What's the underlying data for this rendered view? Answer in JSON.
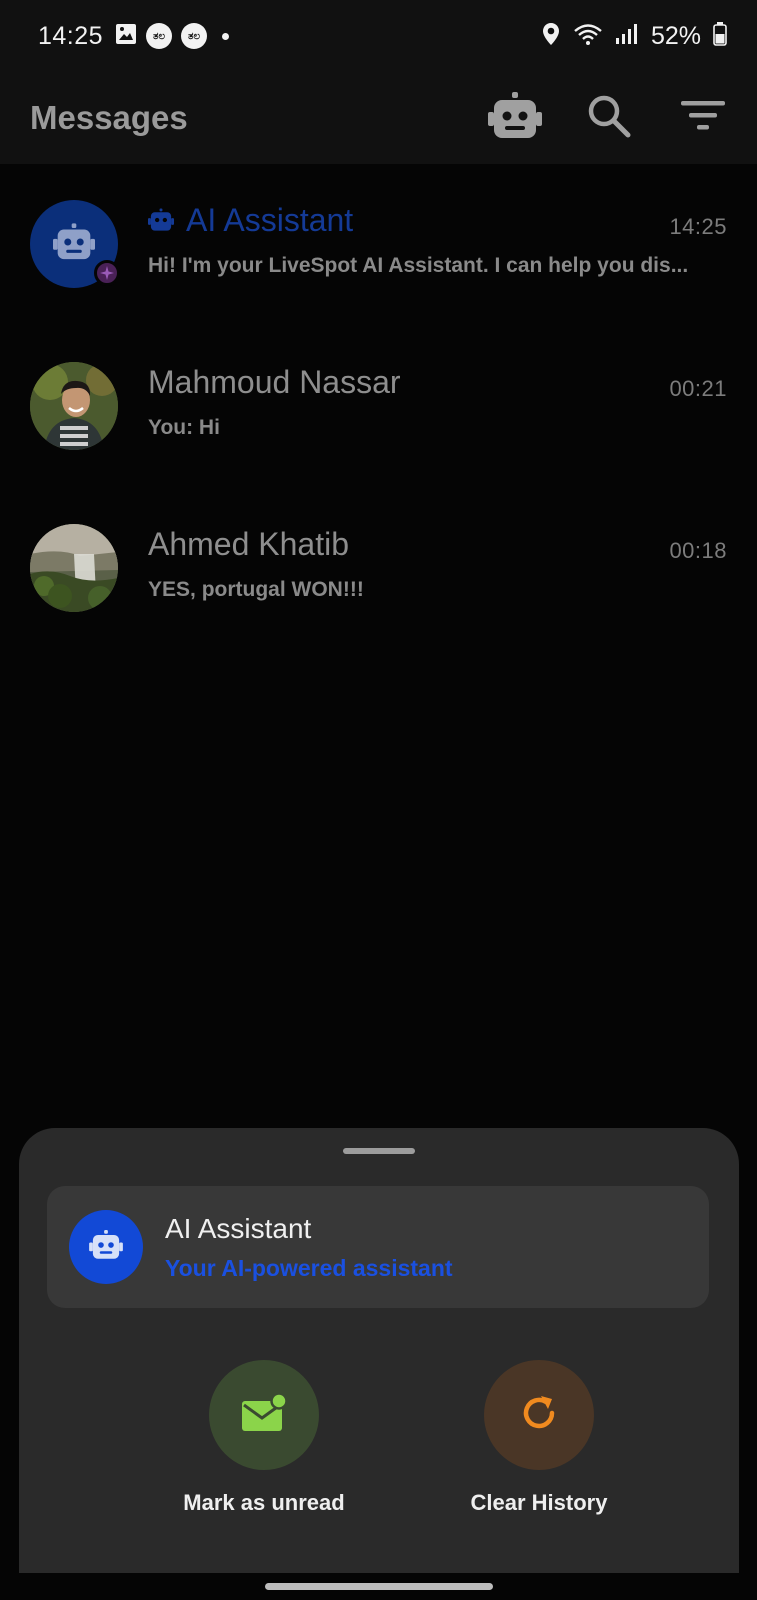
{
  "status_bar": {
    "time": "14:25",
    "left_icons": [
      "image-icon",
      "notification-badge-icon",
      "notification-badge-icon",
      "more-dot-icon"
    ],
    "badge_text": "ತಲ",
    "right_icons": [
      "location-icon",
      "wifi-icon",
      "signal-icon",
      "battery-icon"
    ],
    "battery": "52%"
  },
  "appbar": {
    "title": "Messages",
    "actions": [
      "robot-icon",
      "search-icon",
      "filter-icon"
    ]
  },
  "conversations": [
    {
      "name": "AI Assistant",
      "time": "14:25",
      "preview": "Hi! I'm your LiveSpot AI Assistant. I can help you dis...",
      "is_ai": true
    },
    {
      "name": "Mahmoud Nassar",
      "time": "00:21",
      "preview": "You: Hi",
      "is_ai": false
    },
    {
      "name": "Ahmed Khatib",
      "time": "00:18",
      "preview": "YES, portugal WON!!!",
      "is_ai": false
    }
  ],
  "sheet": {
    "title": "AI Assistant",
    "subtitle": "Your AI-powered assistant",
    "actions": [
      {
        "label": "Mark as unread",
        "icon": "mail-unread-icon",
        "color": "#8bd44a",
        "bg": "#3a4a30"
      },
      {
        "label": "Clear History",
        "icon": "refresh-icon",
        "color": "#f08a1f",
        "bg": "#4a3626"
      }
    ]
  },
  "colors": {
    "accent_blue": "#1249d6",
    "ai_name": "#143a96",
    "background": "#050505",
    "header": "#111111"
  }
}
